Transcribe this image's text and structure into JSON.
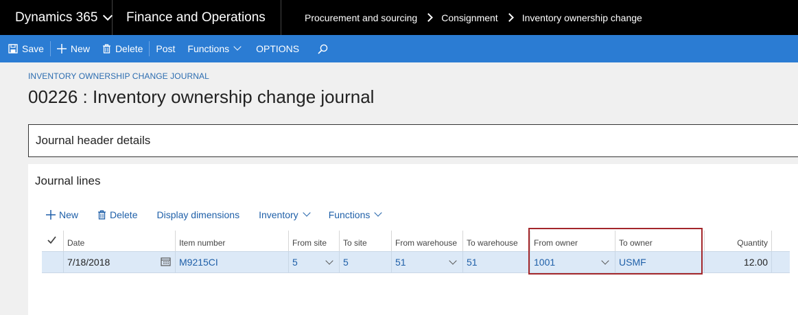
{
  "topbar": {
    "app_name": "Dynamics 365",
    "module_name": "Finance and Operations",
    "breadcrumbs": [
      "Procurement and sourcing",
      "Consignment",
      "Inventory ownership change"
    ]
  },
  "actionbar": {
    "save": "Save",
    "new": "New",
    "delete": "Delete",
    "post": "Post",
    "functions": "Functions",
    "options": "OPTIONS"
  },
  "page": {
    "caption": "INVENTORY OWNERSHIP CHANGE JOURNAL",
    "title": "00226 : Inventory ownership change journal"
  },
  "header_tab": {
    "label": "Journal header details"
  },
  "journal_lines": {
    "title": "Journal lines",
    "toolbar": {
      "new": "New",
      "delete": "Delete",
      "display_dimensions": "Display dimensions",
      "inventory": "Inventory",
      "functions": "Functions"
    },
    "columns": [
      "Date",
      "Item number",
      "From site",
      "To site",
      "From warehouse",
      "To warehouse",
      "From owner",
      "To owner",
      "Quantity"
    ],
    "rows": [
      {
        "date": "7/18/2018",
        "item_number": "M9215CI",
        "from_site": "5",
        "to_site": "5",
        "from_warehouse": "51",
        "to_warehouse": "51",
        "from_owner": "1001",
        "to_owner": "USMF",
        "quantity": "12.00"
      }
    ]
  },
  "colors": {
    "topbar": "#000000",
    "actionbar": "#2b7cd3",
    "link": "#1e5fa8",
    "selected_row": "#dce9f7",
    "highlight_box": "#a3262a"
  }
}
